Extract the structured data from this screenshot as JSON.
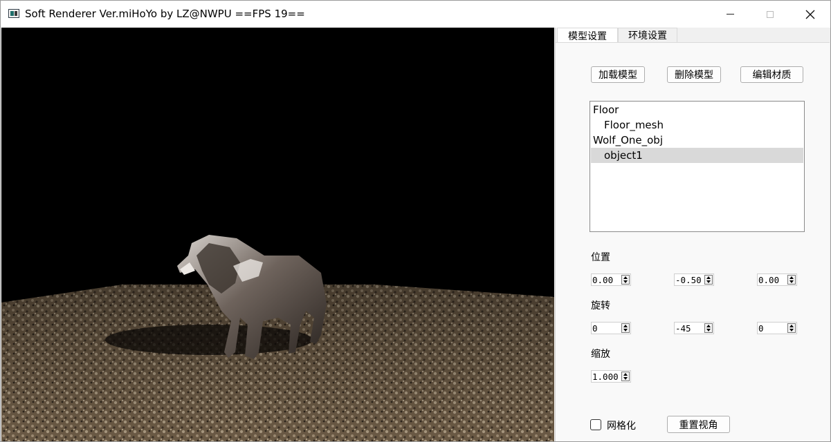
{
  "window": {
    "title": "Soft Renderer Ver.miHoYo by LZ@NWPU ==FPS 19==",
    "minimize_label": "",
    "maximize_label": "",
    "close_glyph": "✕"
  },
  "tabs": [
    {
      "label": "模型设置",
      "active": true
    },
    {
      "label": "环境设置",
      "active": false
    }
  ],
  "buttons": {
    "load_model": "加载模型",
    "delete_model": "删除模型",
    "edit_material": "编辑材质",
    "reset_view": "重置视角"
  },
  "tree": {
    "items": [
      {
        "label": "Floor",
        "level": 0
      },
      {
        "label": "Floor_mesh",
        "level": 1
      },
      {
        "label": "Wolf_One_obj",
        "level": 0
      },
      {
        "label": "object1",
        "level": 1,
        "selected": true
      }
    ]
  },
  "transform": {
    "position_label": "位置",
    "position": [
      "0.00",
      "-0.50",
      "0.00"
    ],
    "rotation_label": "旋转",
    "rotation": [
      "0",
      "-45",
      "0"
    ],
    "scale_label": "缩放",
    "scale": "1.000"
  },
  "wireframe": {
    "label": "网格化",
    "checked": false
  },
  "colors": {
    "viewport_bg": "#000000",
    "panel_bg": "#f0f0f0",
    "selection": "#d9d9d9"
  }
}
